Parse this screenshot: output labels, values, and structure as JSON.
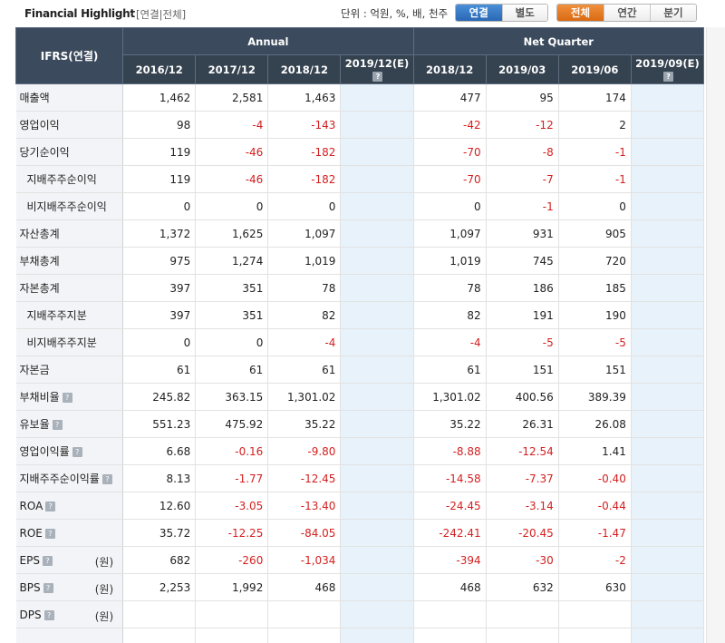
{
  "header": {
    "title": "Financial Highlight",
    "subtitle": "[연결|전체]",
    "unit": "단위 : 억원, %, 배, 천주",
    "toggle1": [
      "연결",
      "별도"
    ],
    "toggle2": [
      "전체",
      "연간",
      "분기"
    ]
  },
  "colors": {
    "negative": "#d41f1f",
    "header_bg": "#3b4a5c",
    "estimate_bg": "#e8f2fa",
    "blue_active": "#2a68b4",
    "orange_active": "#d96a12"
  },
  "table": {
    "corner": "IFRS(연결)",
    "groups": {
      "annual": "Annual",
      "quarter": "Net Quarter"
    },
    "periods": [
      "2016/12",
      "2017/12",
      "2018/12",
      "2019/12(E)",
      "2018/12",
      "2019/03",
      "2019/06",
      "2019/09(E)"
    ],
    "rows": [
      {
        "label": "매출액",
        "indent": false,
        "help": false,
        "unit": "",
        "values": [
          "1,462",
          "2,581",
          "1,463",
          "",
          "477",
          "95",
          "174",
          ""
        ]
      },
      {
        "label": "영업이익",
        "indent": false,
        "help": false,
        "unit": "",
        "values": [
          "98",
          "-4",
          "-143",
          "",
          "-42",
          "-12",
          "2",
          ""
        ]
      },
      {
        "label": "당기순이익",
        "indent": false,
        "help": false,
        "unit": "",
        "values": [
          "119",
          "-46",
          "-182",
          "",
          "-70",
          "-8",
          "-1",
          ""
        ]
      },
      {
        "label": "지배주주순이익",
        "indent": true,
        "help": false,
        "unit": "",
        "values": [
          "119",
          "-46",
          "-182",
          "",
          "-70",
          "-7",
          "-1",
          ""
        ]
      },
      {
        "label": "비지배주주순이익",
        "indent": true,
        "help": false,
        "unit": "",
        "values": [
          "0",
          "0",
          "0",
          "",
          "0",
          "-1",
          "0",
          ""
        ]
      },
      {
        "label": "자산총계",
        "indent": false,
        "help": false,
        "unit": "",
        "values": [
          "1,372",
          "1,625",
          "1,097",
          "",
          "1,097",
          "931",
          "905",
          ""
        ]
      },
      {
        "label": "부채총계",
        "indent": false,
        "help": false,
        "unit": "",
        "values": [
          "975",
          "1,274",
          "1,019",
          "",
          "1,019",
          "745",
          "720",
          ""
        ]
      },
      {
        "label": "자본총계",
        "indent": false,
        "help": false,
        "unit": "",
        "values": [
          "397",
          "351",
          "78",
          "",
          "78",
          "186",
          "185",
          ""
        ]
      },
      {
        "label": "지배주주지분",
        "indent": true,
        "help": false,
        "unit": "",
        "values": [
          "397",
          "351",
          "82",
          "",
          "82",
          "191",
          "190",
          ""
        ]
      },
      {
        "label": "비지배주주지분",
        "indent": true,
        "help": false,
        "unit": "",
        "values": [
          "0",
          "0",
          "-4",
          "",
          "-4",
          "-5",
          "-5",
          ""
        ]
      },
      {
        "label": "자본금",
        "indent": false,
        "help": false,
        "unit": "",
        "values": [
          "61",
          "61",
          "61",
          "",
          "61",
          "151",
          "151",
          ""
        ]
      },
      {
        "label": "부채비율",
        "indent": false,
        "help": true,
        "unit": "",
        "values": [
          "245.82",
          "363.15",
          "1,301.02",
          "",
          "1,301.02",
          "400.56",
          "389.39",
          ""
        ]
      },
      {
        "label": "유보율",
        "indent": false,
        "help": true,
        "unit": "",
        "values": [
          "551.23",
          "475.92",
          "35.22",
          "",
          "35.22",
          "26.31",
          "26.08",
          ""
        ]
      },
      {
        "label": "영업이익률",
        "indent": false,
        "help": true,
        "unit": "",
        "values": [
          "6.68",
          "-0.16",
          "-9.80",
          "",
          "-8.88",
          "-12.54",
          "1.41",
          ""
        ]
      },
      {
        "label": "지배주주순이익률",
        "indent": false,
        "help": true,
        "unit": "",
        "values": [
          "8.13",
          "-1.77",
          "-12.45",
          "",
          "-14.58",
          "-7.37",
          "-0.40",
          ""
        ]
      },
      {
        "label": "ROA",
        "indent": false,
        "help": true,
        "unit": "",
        "values": [
          "12.60",
          "-3.05",
          "-13.40",
          "",
          "-24.45",
          "-3.14",
          "-0.44",
          ""
        ]
      },
      {
        "label": "ROE",
        "indent": false,
        "help": true,
        "unit": "",
        "values": [
          "35.72",
          "-12.25",
          "-84.05",
          "",
          "-242.41",
          "-20.45",
          "-1.47",
          ""
        ]
      },
      {
        "label": "EPS",
        "indent": false,
        "help": true,
        "unit": "(원)",
        "values": [
          "682",
          "-260",
          "-1,034",
          "",
          "-394",
          "-30",
          "-2",
          ""
        ]
      },
      {
        "label": "BPS",
        "indent": false,
        "help": true,
        "unit": "(원)",
        "values": [
          "2,253",
          "1,992",
          "468",
          "",
          "468",
          "632",
          "630",
          ""
        ]
      },
      {
        "label": "DPS",
        "indent": false,
        "help": true,
        "unit": "(원)",
        "values": [
          "",
          "",
          "",
          "",
          "",
          "",
          "",
          ""
        ]
      },
      {
        "label": "",
        "indent": false,
        "help": false,
        "unit": "",
        "values": [
          "",
          "",
          "",
          "",
          "",
          "",
          "",
          ""
        ]
      }
    ]
  }
}
